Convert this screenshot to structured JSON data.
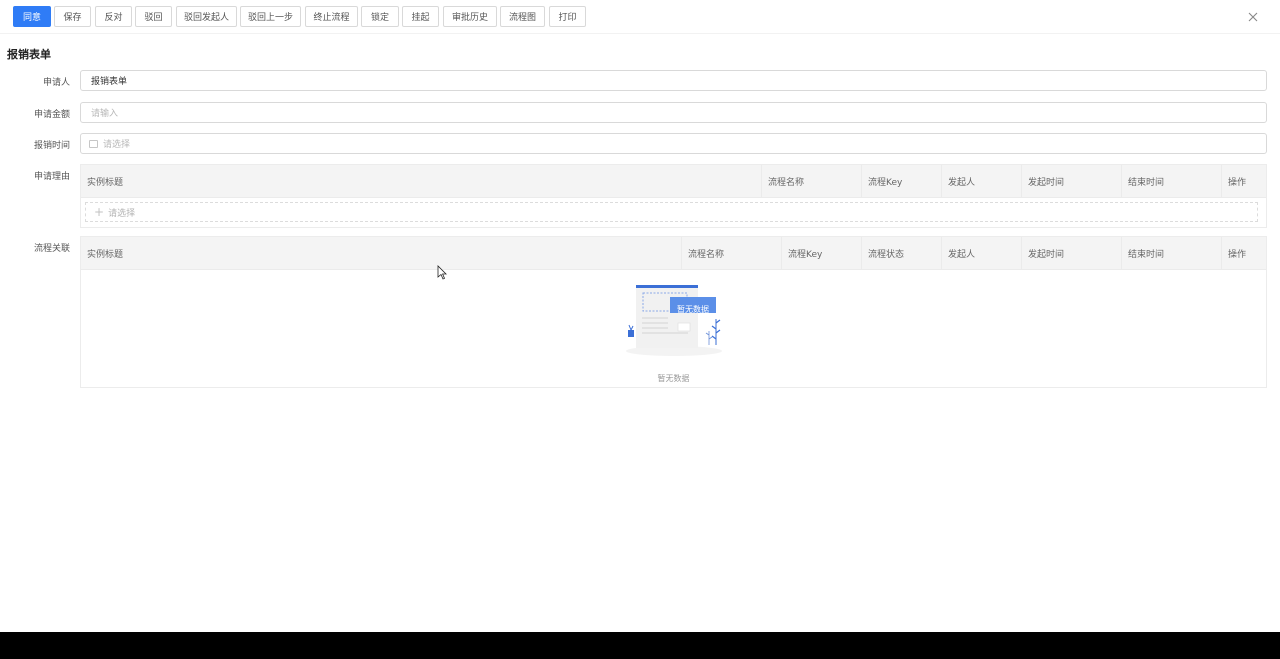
{
  "toolbar": {
    "buttons": [
      {
        "label": "同意",
        "primary": true
      },
      {
        "label": "保存"
      },
      {
        "label": "反对"
      },
      {
        "label": "驳回"
      },
      {
        "label": "驳回发起人"
      },
      {
        "label": "驳回上一步"
      },
      {
        "label": "终止流程"
      },
      {
        "label": "锁定"
      },
      {
        "label": "挂起"
      },
      {
        "label": "审批历史"
      },
      {
        "label": "流程图"
      },
      {
        "label": "打印"
      }
    ],
    "close_icon": "close-icon"
  },
  "form": {
    "title": "报销表单",
    "applicant": {
      "label": "申请人",
      "value": "报销表单"
    },
    "amount": {
      "label": "申请金额",
      "placeholder": "请输入"
    },
    "time": {
      "label": "报销时间",
      "placeholder": "请选择"
    },
    "reason": {
      "label": "申请理由",
      "columns": [
        "实例标题",
        "流程名称",
        "流程Key",
        "发起人",
        "发起时间",
        "结束时间",
        "操作"
      ],
      "add_placeholder": "请选择"
    },
    "relation": {
      "label": "流程关联",
      "columns": [
        "实例标题",
        "流程名称",
        "流程Key",
        "流程状态",
        "发起人",
        "发起时间",
        "结束时间",
        "操作"
      ],
      "empty_badge": "暂无数据",
      "empty_text": "暂无数据"
    }
  },
  "colors": {
    "primary": "#2f7cf6",
    "border": "#d9d9d9",
    "header_bg": "#f4f4f4"
  }
}
